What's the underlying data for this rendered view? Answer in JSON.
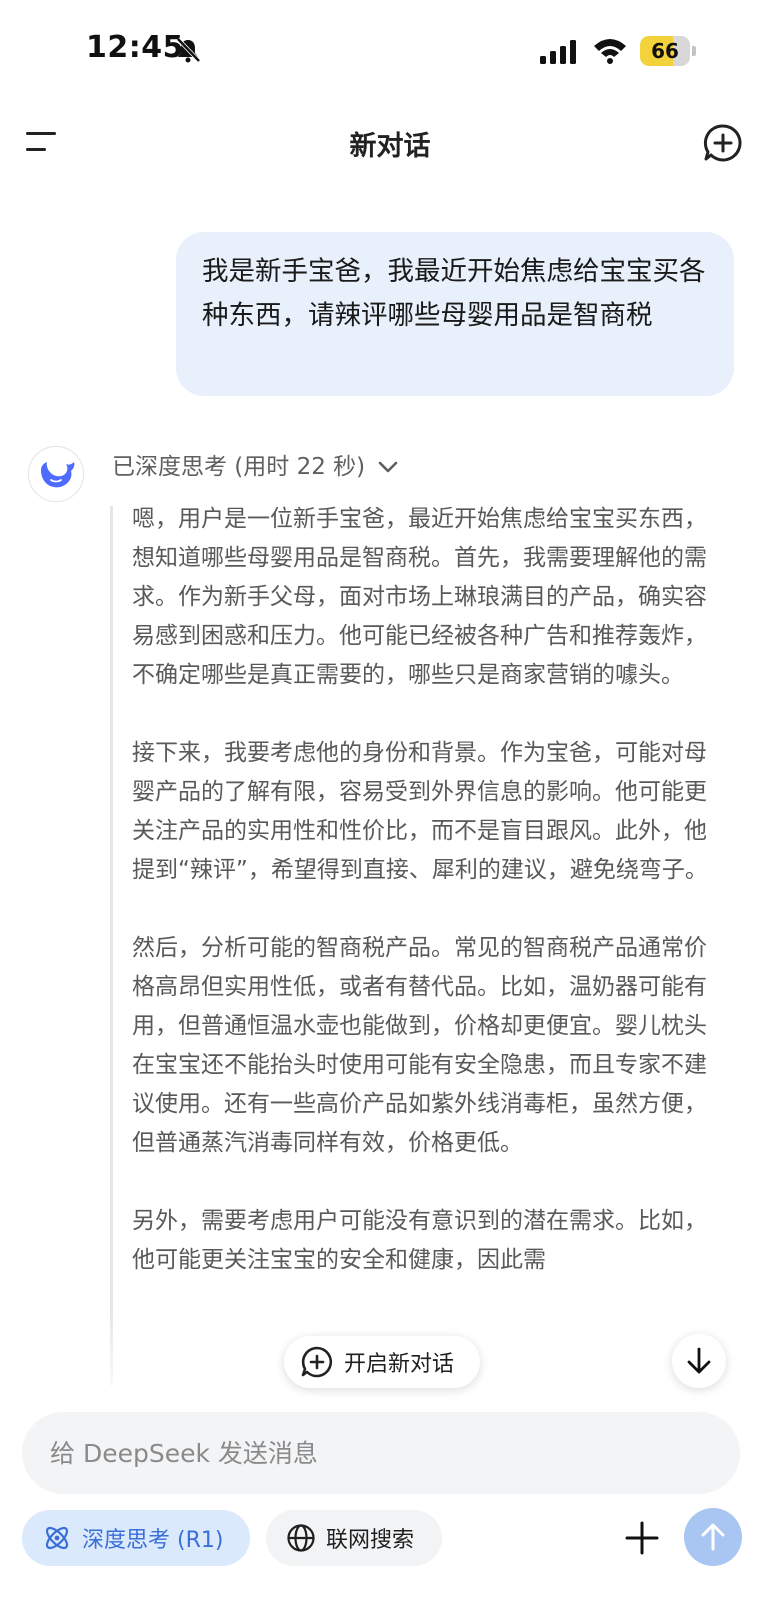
{
  "status_bar": {
    "time": "12:45",
    "battery": "66",
    "battery_level": 0.66
  },
  "nav": {
    "title": "新对话"
  },
  "user_message": "我是新手宝爸，我最近开始焦虑给宝宝买各种东西，请辣评哪些母婴用品是智商税",
  "assistant": {
    "thinking_label": "已深度思考 (用时 22 秒)",
    "thinking_paragraphs": [
      "嗯，用户是一位新手宝爸，最近开始焦虑给宝宝买东西，想知道哪些母婴用品是智商税。首先，我需要理解他的需求。作为新手父母，面对市场上琳琅满目的产品，确实容易感到困惑和压力。他可能已经被各种广告和推荐轰炸，不确定哪些是真正需要的，哪些只是商家营销的噱头。",
      "接下来，我要考虑他的身份和背景。作为宝爸，可能对母婴产品的了解有限，容易受到外界信息的影响。他可能更关注产品的实用性和性价比，而不是盲目跟风。此外，他提到“辣评”，希望得到直接、犀利的建议，避免绕弯子。",
      "然后，分析可能的智商税产品。常见的智商税产品通常价格高昂但实用性低，或者有替代品。比如，温奶器可能有用，但普通恒温水壶也能做到，价格却更便宜。婴儿枕头在宝宝还不能抬头时使用可能有安全隐患，而且专家不建议使用。还有一些高价产品如紫外线消毒柜，虽然方便，但普通蒸汽消毒同样有效，价格更低。",
      "另外，需要考虑用户可能没有意识到的潜在需求。比如，他可能更关注宝宝的安全和健康，因此需"
    ]
  },
  "floating": {
    "new_conversation": "开启新对话"
  },
  "input": {
    "placeholder": "给 DeepSeek 发送消息"
  },
  "toolbar": {
    "deep_think": "深度思考 (R1)",
    "web_search": "联网搜索"
  },
  "colors": {
    "accent": "#3a6fd8",
    "user_bubble": "#e8f0fb",
    "chip_active": "#dbe9fc",
    "send_button": "#a9c5f1"
  }
}
